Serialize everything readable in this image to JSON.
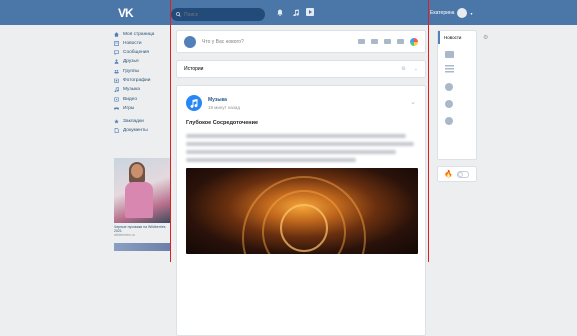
{
  "header": {
    "logo": "VK",
    "search_placeholder": "Поиск",
    "user_name": "Екатерина"
  },
  "sidebar": {
    "items": [
      {
        "label": "Моя страница",
        "icon": "home-icon"
      },
      {
        "label": "Новости",
        "icon": "news-icon"
      },
      {
        "label": "Сообщения",
        "icon": "message-icon"
      },
      {
        "label": "Друзья",
        "icon": "friends-icon"
      },
      {
        "label": "Группы",
        "icon": "groups-icon"
      },
      {
        "label": "Фотографии",
        "icon": "photo-icon"
      },
      {
        "label": "Музыка",
        "icon": "music-icon"
      },
      {
        "label": "Видео",
        "icon": "video-icon"
      },
      {
        "label": "Игры",
        "icon": "games-icon"
      },
      {
        "label": "Закладки",
        "icon": "star-icon"
      },
      {
        "label": "Документы",
        "icon": "docs-icon"
      }
    ],
    "ad": {
      "title": "Черные пуховики на Wildberries 2021",
      "subtitle": "wildberries.ru"
    }
  },
  "composer": {
    "placeholder": "Что у Вас нового?"
  },
  "stories": {
    "label": "Истории"
  },
  "post": {
    "author": "Музыка",
    "time": "19 минут назад",
    "title": "Глубокое Сосредоточение"
  },
  "right": {
    "tab": "Новости"
  },
  "colors": {
    "topbar": "#4a76a8",
    "background": "#edeef0",
    "guide": "#e02020"
  }
}
